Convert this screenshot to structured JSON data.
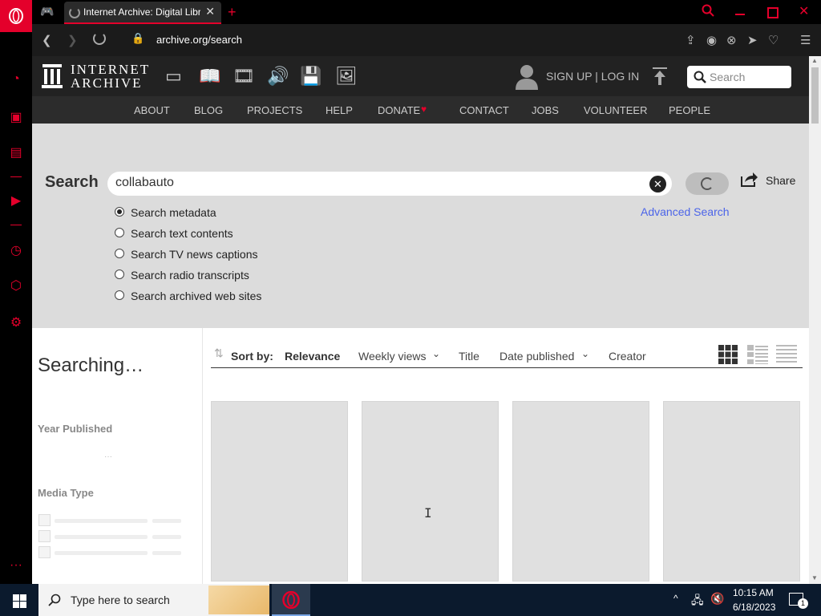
{
  "browser": {
    "tab_title": "Internet Archive: Digital Libr",
    "url": "archive.org/search"
  },
  "ia": {
    "logo_line1": "INTERNET",
    "logo_line2": "ARCHIVE",
    "signup_label": "SIGN UP | LOG IN",
    "search_placeholder": "Search",
    "nav": [
      "ABOUT",
      "BLOG",
      "PROJECTS",
      "HELP",
      "DONATE",
      "CONTACT",
      "JOBS",
      "VOLUNTEER",
      "PEOPLE"
    ]
  },
  "search": {
    "label": "Search",
    "query": "collabauto",
    "share_label": "Share",
    "advanced_label": "Advanced Search",
    "options": [
      {
        "label": "Search metadata",
        "selected": true
      },
      {
        "label": "Search text contents",
        "selected": false
      },
      {
        "label": "Search TV news captions",
        "selected": false
      },
      {
        "label": "Search radio transcripts",
        "selected": false
      },
      {
        "label": "Search archived web sites",
        "selected": false
      }
    ]
  },
  "results": {
    "status": "Searching…",
    "facet_year": "Year Published",
    "facet_media": "Media Type",
    "sort_label": "Sort by:",
    "sort_options": [
      "Relevance",
      "Weekly views",
      "Title",
      "Date published",
      "Creator"
    ]
  },
  "taskbar": {
    "search_placeholder": "Type here to search",
    "time": "10:15 AM",
    "date": "6/18/2023",
    "notification_count": "1"
  },
  "colors": {
    "opera_red": "#e4002b",
    "ia_dark": "#222222",
    "link_blue": "#4b64e9"
  }
}
